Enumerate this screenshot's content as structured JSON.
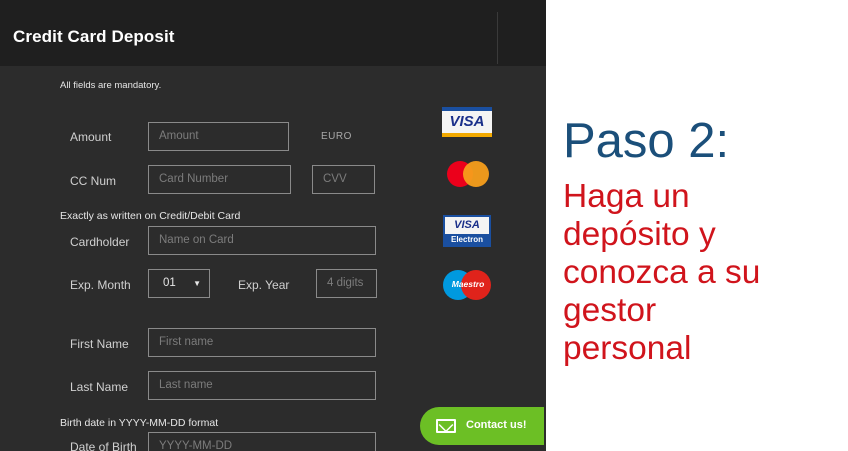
{
  "form": {
    "title": "Credit Card Deposit",
    "mandatory_note": "All fields are mandatory.",
    "amount": {
      "label": "Amount",
      "placeholder": "Amount",
      "currency": "EURO"
    },
    "cc_num": {
      "label": "CC Num",
      "placeholder": "Card Number",
      "cvv_placeholder": "CVV"
    },
    "card_note": "Exactly as written on Credit/Debit Card",
    "cardholder": {
      "label": "Cardholder",
      "placeholder": "Name on Card"
    },
    "exp_month": {
      "label": "Exp. Month",
      "value": "01"
    },
    "exp_year": {
      "label": "Exp. Year",
      "placeholder": "4 digits"
    },
    "first_name": {
      "label": "First Name",
      "placeholder": "First name"
    },
    "last_name": {
      "label": "Last Name",
      "placeholder": "Last name"
    },
    "birth_note": "Birth date in YYYY-MM-DD format",
    "dob": {
      "label": "Date of Birth",
      "placeholder": "YYYY-MM-DD"
    }
  },
  "card_logos": [
    {
      "name": "visa",
      "text": "VISA"
    },
    {
      "name": "mastercard"
    },
    {
      "name": "visa-electron",
      "text": "VISA",
      "sub": "Electron"
    },
    {
      "name": "maestro",
      "text": "Maestro"
    }
  ],
  "contact_button": {
    "label": "Contact us!",
    "icon": "envelope-icon",
    "color": "#6cbf25"
  },
  "promo": {
    "heading": "Paso 2:",
    "lines": [
      "Haga un",
      "depósito y",
      "conozca a su",
      "gestor",
      "personal"
    ],
    "heading_color": "#1b4f7a",
    "text_color": "#d0141c"
  }
}
